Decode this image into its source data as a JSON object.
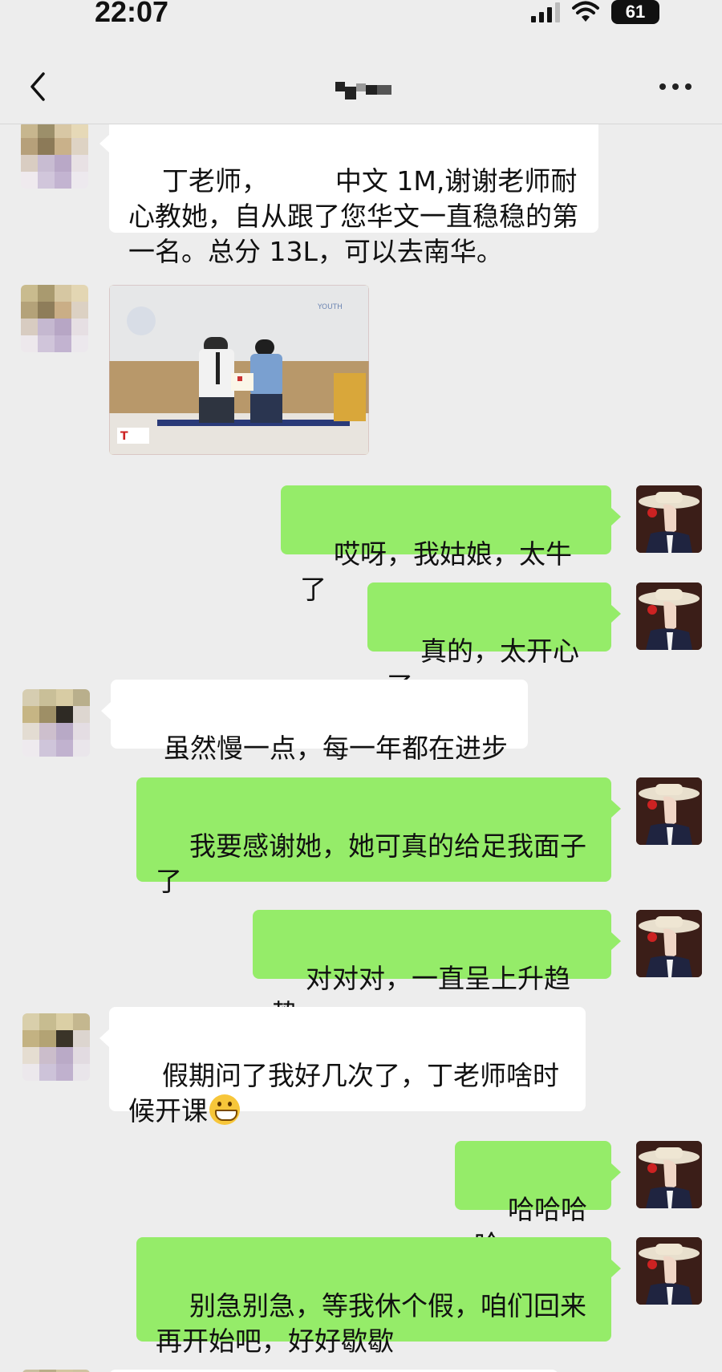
{
  "status_bar": {
    "time": "22:07",
    "battery": "61"
  },
  "nav": {
    "title": "",
    "back_icon": "chevron-left-icon",
    "more_icon": "more-dots-icon"
  },
  "messages": [
    {
      "side": "in",
      "text": "丁老师，        中文 1M,谢谢老师耐心教她，自从跟了您华文一直稳稳的第一名。总分 13L，可以去南华。"
    },
    {
      "side": "in",
      "type": "image"
    },
    {
      "side": "out",
      "text": "哎呀，我姑娘，太牛了"
    },
    {
      "side": "out",
      "text": "真的，太开心了"
    },
    {
      "side": "in",
      "text": "虽然慢一点，每一年都在进步"
    },
    {
      "side": "out",
      "text": "我要感谢她，她可真的给足我面子了"
    },
    {
      "side": "out",
      "text": "对对对，一直呈上升趋势"
    },
    {
      "side": "in",
      "text": "假期问了我好几次了，丁老师啥时候开课",
      "emoji": "grinning-face-emoji"
    },
    {
      "side": "out",
      "text": "哈哈哈哈"
    },
    {
      "side": "out",
      "text": "别急别急，等我休个假，咱们回来再开始吧，好好歇歇"
    }
  ],
  "colors": {
    "background": "#ededed",
    "incoming_bubble": "#ffffff",
    "outgoing_bubble": "#95ec69"
  }
}
